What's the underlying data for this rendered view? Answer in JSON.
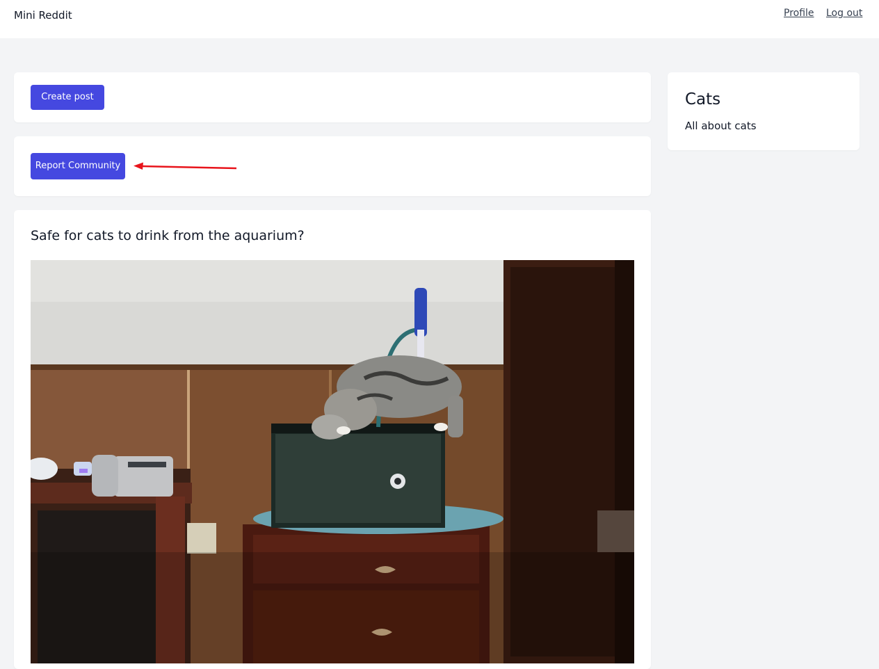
{
  "header": {
    "brand": "Mini Reddit",
    "links": {
      "profile": "Profile",
      "logout": "Log out"
    }
  },
  "main": {
    "create_post_label": "Create post",
    "report_community_label": "Report Community",
    "post": {
      "title": "Safe for cats to drink from the aquarium?",
      "image_alt": "cat-drinking-from-aquarium"
    }
  },
  "sidebar": {
    "community_name": "Cats",
    "community_description": "All about cats"
  },
  "colors": {
    "accent": "#4548e0",
    "page_bg": "#f3f4f6",
    "annotation_arrow": "#e8141b"
  }
}
